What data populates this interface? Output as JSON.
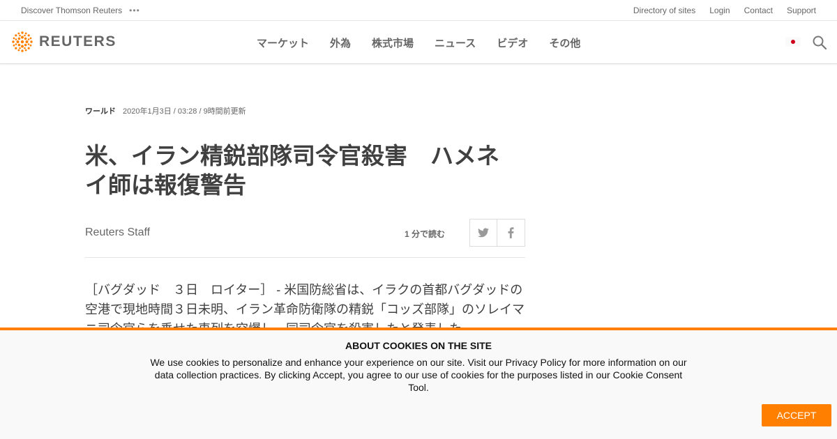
{
  "utility_bar": {
    "discover": "Discover Thomson Reuters",
    "more": "•••",
    "links": [
      "Directory of sites",
      "Login",
      "Contact",
      "Support"
    ]
  },
  "header": {
    "logo_text": "REUTERS",
    "nav": [
      "マーケット",
      "外為",
      "株式市場",
      "ニュース",
      "ビデオ",
      "その他"
    ],
    "brand_color": "#ff8000"
  },
  "article": {
    "section": "ワールド",
    "date": "2020年1月3日 / 03:28 / 9時間前更新",
    "headline": "米、イラン精鋭部隊司令官殺害　ハメネイ師は報復警告",
    "author": "Reuters Staff",
    "read_time": "1 分で読む",
    "share_icons": [
      "twitter-icon",
      "facebook-icon"
    ],
    "body": "［バグダッド　３日　ロイター］ - 米国防総省は、イラクの首都バグダッドの空港で現地時間３日未明、イラン革命防衛隊の精鋭「コッズ部隊」のソレイマニ司令官らを乗せた車列を空爆し、同司令官を殺害したと発表した。"
  },
  "cookie_banner": {
    "title": "ABOUT COOKIES ON THE SITE",
    "text": "We use cookies to personalize and enhance your experience on our site. Visit our Privacy Policy for more information on our data collection practices. By clicking Accept, you agree to our use of cookies for the purposes listed in our Cookie Consent Tool.",
    "accept": "ACCEPT"
  }
}
